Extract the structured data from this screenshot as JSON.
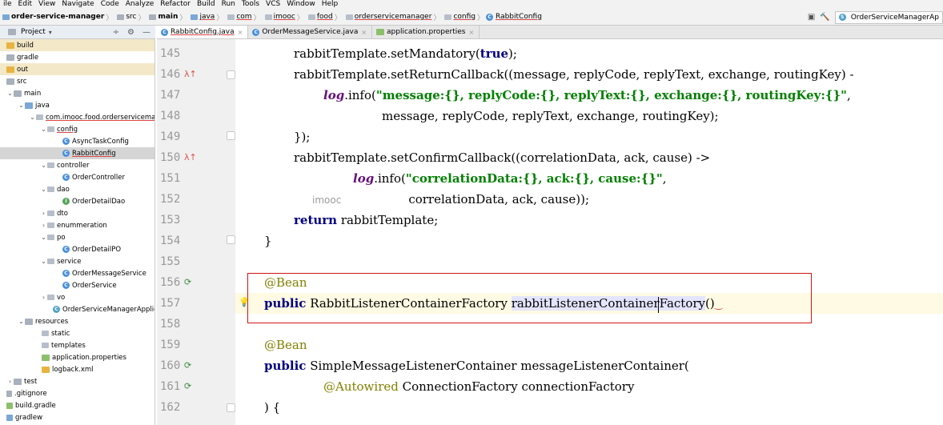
{
  "menu": [
    "ile",
    "Edit",
    "View",
    "Navigate",
    "Code",
    "Analyze",
    "Refactor",
    "Build",
    "Run",
    "Tools",
    "VCS",
    "Window",
    "Help"
  ],
  "breadcrumb": [
    "order-service-manager",
    "src",
    "main",
    "java",
    "com",
    "imooc",
    "food",
    "orderservicemanager",
    "config",
    "RabbitConfig"
  ],
  "run_config": "OrderServiceManagerAp",
  "project_panel": {
    "title": "Project",
    "tree": [
      {
        "label": "build",
        "icon": "folder-icon-orange"
      },
      {
        "label": "gradle",
        "icon": "folder-icon-gray"
      },
      {
        "label": "out",
        "icon": "folder-icon-orange"
      },
      {
        "label": "src",
        "icon": "folder-icon-gray"
      },
      {
        "label": "main",
        "icon": "folder-icon-gray"
      },
      {
        "label": "java",
        "icon": "folder-icon-blue"
      },
      {
        "label": "com.imooc.food.orderservicema",
        "icon": "package-icon"
      },
      {
        "label": "config",
        "icon": "package-icon"
      },
      {
        "label": "AsyncTaskConfig",
        "icon": "class-icon"
      },
      {
        "label": "RabbitConfig",
        "icon": "class-icon"
      },
      {
        "label": "controller",
        "icon": "package-icon"
      },
      {
        "label": "OrderController",
        "icon": "class-icon"
      },
      {
        "label": "dao",
        "icon": "package-icon"
      },
      {
        "label": "OrderDetailDao",
        "icon": "interface-icon"
      },
      {
        "label": "dto",
        "icon": "package-icon"
      },
      {
        "label": "enummeration",
        "icon": "package-icon"
      },
      {
        "label": "po",
        "icon": "package-icon"
      },
      {
        "label": "OrderDetailPO",
        "icon": "class-icon"
      },
      {
        "label": "service",
        "icon": "package-icon"
      },
      {
        "label": "OrderMessageService",
        "icon": "class-icon"
      },
      {
        "label": "OrderService",
        "icon": "class-icon"
      },
      {
        "label": "vo",
        "icon": "package-icon"
      },
      {
        "label": "OrderServiceManagerApplic",
        "icon": "spring-class-icon"
      },
      {
        "label": "resources",
        "icon": "folder-icon-gray"
      },
      {
        "label": "static",
        "icon": "folder-icon-gray"
      },
      {
        "label": "templates",
        "icon": "folder-icon-gray"
      },
      {
        "label": "application.properties",
        "icon": "properties-icon"
      },
      {
        "label": "logback.xml",
        "icon": "xml-icon"
      },
      {
        "label": "test",
        "icon": "folder-icon-gray"
      },
      {
        "label": ".gitignore",
        "icon": "file-icon"
      },
      {
        "label": "build.gradle",
        "icon": "gradle-icon"
      },
      {
        "label": "gradlew",
        "icon": "file-icon"
      }
    ]
  },
  "tabs": [
    "RabbitConfig.java",
    "OrderMessageService.java",
    "application.properties"
  ],
  "line_numbers": [
    "145",
    "146",
    "147",
    "148",
    "149",
    "150",
    "151",
    "152",
    "153",
    "154",
    "155",
    "156",
    "157",
    "158",
    "159",
    "160",
    "161",
    "162"
  ],
  "code": {
    "l145": [
      "rabbitTemplate.setMandatory(",
      "true",
      ");"
    ],
    "l146": [
      "rabbitTemplate.setReturnCallback((message, replyCode, replyText, exchange, routingKey) -"
    ],
    "l147": [
      "log",
      ".info(",
      "\"message:{}, replyCode:{}, replyText:{}, exchange:{}, routingKey:{}\"",
      ","
    ],
    "l148": [
      "message, replyCode, replyText, exchange, routingKey);"
    ],
    "l149": [
      "});"
    ],
    "l150": [
      "rabbitTemplate.setConfirmCallback((correlationData, ack, cause) ->"
    ],
    "l151": [
      "log",
      ".info(",
      "\"correlationData:{}, ack:{}, cause:{}\"",
      ","
    ],
    "l152": [
      "imooc",
      "correlationData, ack, cause));"
    ],
    "l153": [
      "return",
      " rabbitTemplate;"
    ],
    "l154": [
      "}"
    ],
    "l156": [
      "@Bean"
    ],
    "l157": [
      "public",
      " RabbitListenerContainerFactory ",
      "rabbitListenerContainerFactory",
      "()"
    ],
    "l159": [
      "@Bean"
    ],
    "l160": [
      "public",
      " SimpleMessageListenerContainer messageListenerContainer("
    ],
    "l161": [
      "@Autowired",
      " ConnectionFactory connectionFactory"
    ],
    "l162": [
      ") {"
    ]
  }
}
